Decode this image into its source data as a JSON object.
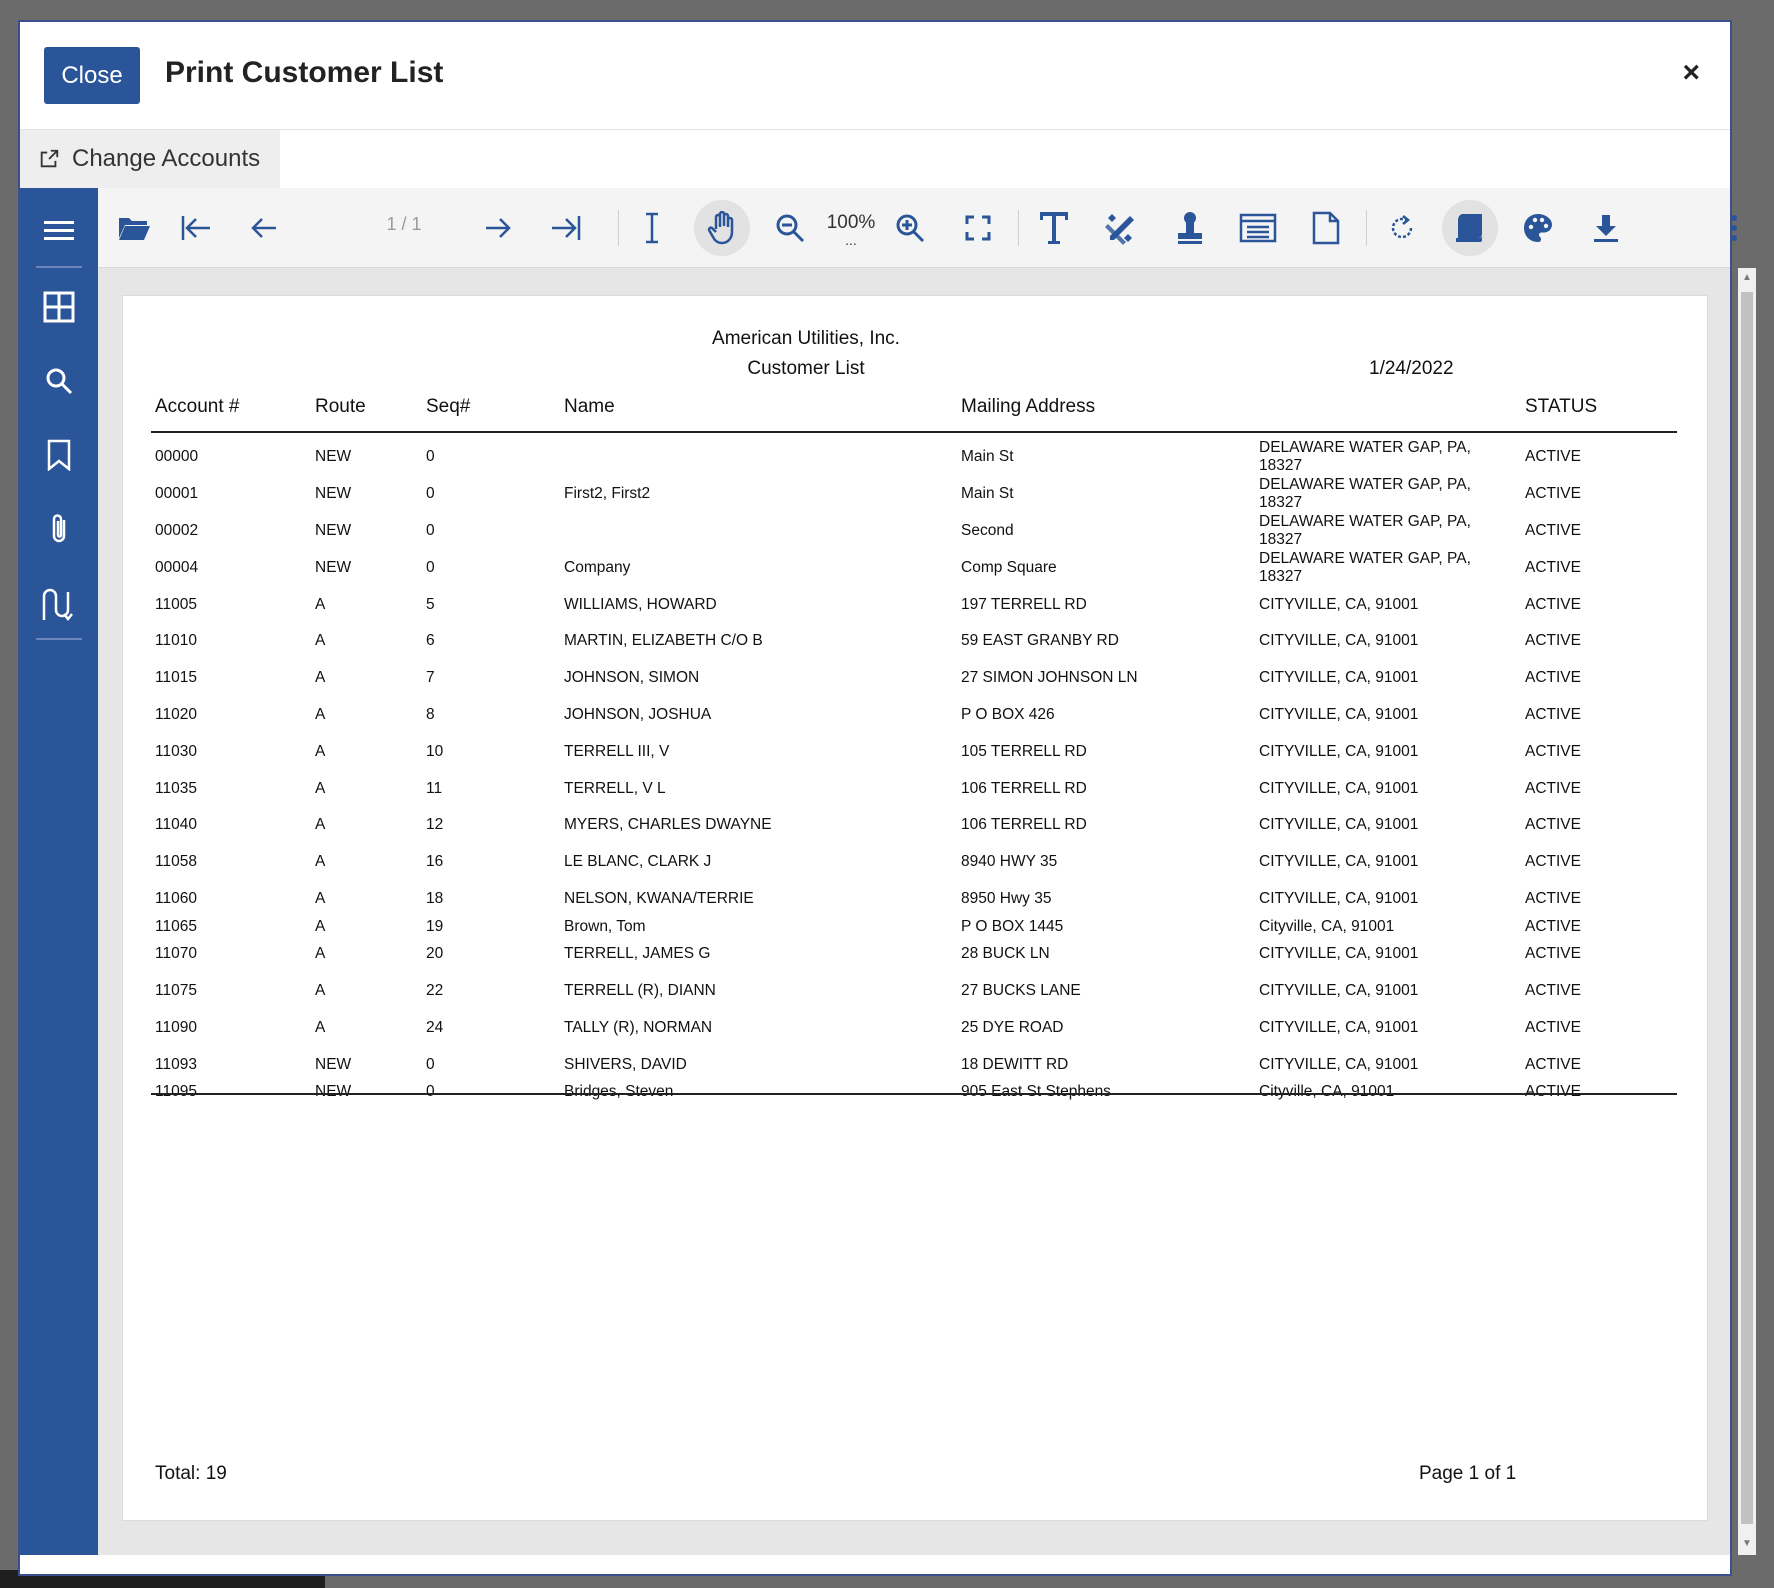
{
  "dialog": {
    "close_label": "Close",
    "title": "Print Customer List",
    "x_label": "×",
    "change_accounts_label": "Change Accounts"
  },
  "toolbar": {
    "page_indicator": "1 / 1",
    "zoom": "100%",
    "zoom_more": "..."
  },
  "report": {
    "company": "American Utilities, Inc.",
    "title": "Customer List",
    "date": "1/24/2022",
    "headers": [
      "Account #",
      "Route",
      "Seq#",
      "Name",
      "Mailing Address",
      "STATUS"
    ],
    "rows": [
      {
        "account": "00000",
        "route": "NEW",
        "seq": "0",
        "name": "",
        "addr1": "Main St",
        "addr2": "DELAWARE WATER GAP, PA, 18327",
        "status": "ACTIVE"
      },
      {
        "account": "00001",
        "route": "NEW",
        "seq": "0",
        "name": "First2, First2",
        "addr1": "Main St",
        "addr2": "DELAWARE WATER GAP, PA, 18327",
        "status": "ACTIVE"
      },
      {
        "account": "00002",
        "route": "NEW",
        "seq": "0",
        "name": "",
        "addr1": "Second",
        "addr2": "DELAWARE WATER GAP, PA, 18327",
        "status": "ACTIVE"
      },
      {
        "account": "00004",
        "route": "NEW",
        "seq": "0",
        "name": "Company",
        "addr1": "Comp Square",
        "addr2": "DELAWARE WATER GAP, PA, 18327",
        "status": "ACTIVE"
      },
      {
        "account": "11005",
        "route": "A",
        "seq": "5",
        "name": "WILLIAMS, HOWARD",
        "addr1": "197 TERRELL RD",
        "addr2": "CITYVILLE, CA, 91001",
        "status": "ACTIVE"
      },
      {
        "account": "11010",
        "route": "A",
        "seq": "6",
        "name": "MARTIN, ELIZABETH C/O B",
        "addr1": "59 EAST GRANBY RD",
        "addr2": "CITYVILLE, CA, 91001",
        "status": "ACTIVE"
      },
      {
        "account": "11015",
        "route": "A",
        "seq": "7",
        "name": "JOHNSON, SIMON",
        "addr1": "27 SIMON JOHNSON LN",
        "addr2": "CITYVILLE, CA, 91001",
        "status": "ACTIVE"
      },
      {
        "account": "11020",
        "route": "A",
        "seq": "8",
        "name": "JOHNSON, JOSHUA",
        "addr1": "P O BOX 426",
        "addr2": "CITYVILLE, CA, 91001",
        "status": "ACTIVE"
      },
      {
        "account": "11030",
        "route": "A",
        "seq": "10",
        "name": "TERRELL III, V",
        "addr1": "105 TERRELL RD",
        "addr2": "CITYVILLE, CA, 91001",
        "status": "ACTIVE"
      },
      {
        "account": "11035",
        "route": "A",
        "seq": "11",
        "name": "TERRELL, V L",
        "addr1": "106 TERRELL RD",
        "addr2": "CITYVILLE, CA, 91001",
        "status": "ACTIVE"
      },
      {
        "account": "11040",
        "route": "A",
        "seq": "12",
        "name": "MYERS, CHARLES DWAYNE",
        "addr1": "106 TERRELL RD",
        "addr2": "CITYVILLE, CA, 91001",
        "status": "ACTIVE"
      },
      {
        "account": "11058",
        "route": "A",
        "seq": "16",
        "name": "LE BLANC, CLARK J",
        "addr1": "8940 HWY 35",
        "addr2": "CITYVILLE, CA, 91001",
        "status": "ACTIVE"
      },
      {
        "account": "11060",
        "route": "A",
        "seq": "18",
        "name": "NELSON, KWANA/TERRIE",
        "addr1": "8950 Hwy 35",
        "addr2": "CITYVILLE, CA, 91001",
        "status": "ACTIVE"
      },
      {
        "account": "11065",
        "route": "A",
        "seq": "19",
        "name": "Brown, Tom",
        "addr1": "P O BOX 1445",
        "addr2": "Cityville, CA, 91001",
        "status": "ACTIVE"
      },
      {
        "account": "11070",
        "route": "A",
        "seq": "20",
        "name": "TERRELL, JAMES G",
        "addr1": "28 BUCK LN",
        "addr2": "CITYVILLE, CA, 91001",
        "status": "ACTIVE"
      },
      {
        "account": "11075",
        "route": "A",
        "seq": "22",
        "name": "TERRELL (R), DIANN",
        "addr1": "27 BUCKS LANE",
        "addr2": "CITYVILLE, CA, 91001",
        "status": "ACTIVE"
      },
      {
        "account": "11090",
        "route": "A",
        "seq": "24",
        "name": "TALLY (R), NORMAN",
        "addr1": "25 DYE ROAD",
        "addr2": "CITYVILLE, CA, 91001",
        "status": "ACTIVE"
      },
      {
        "account": "11093",
        "route": "NEW",
        "seq": "0",
        "name": "SHIVERS, DAVID",
        "addr1": "18 DEWITT RD",
        "addr2": "CITYVILLE, CA, 91001",
        "status": "ACTIVE"
      },
      {
        "account": "11095",
        "route": "NEW",
        "seq": "0",
        "name": "Bridges, Steven",
        "addr1": "905 East St Stephens",
        "addr2": "Cityville, CA, 91001",
        "status": "ACTIVE"
      }
    ],
    "total": "Total: 19",
    "page_of": "Page 1 of 1"
  }
}
